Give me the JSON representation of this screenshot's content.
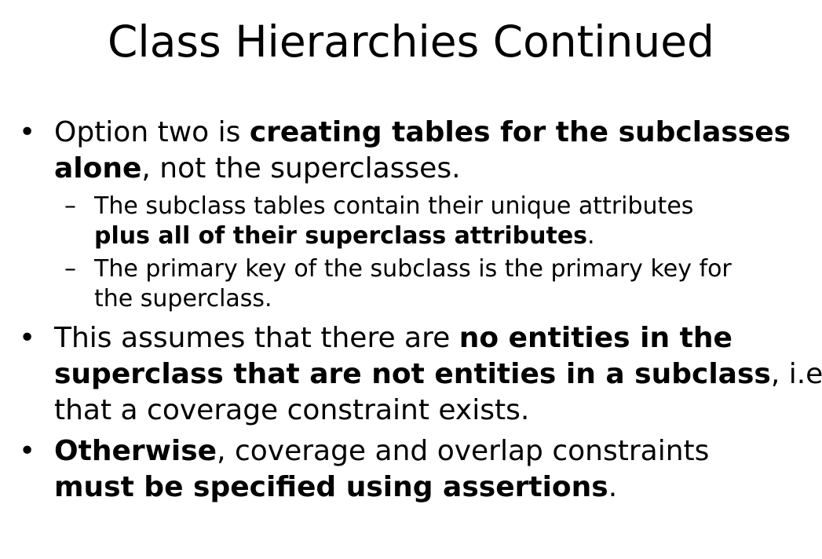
{
  "slide": {
    "title": "Class Hierarchies Continued",
    "bullet_marker": "•",
    "dash_marker": "–",
    "bullets": [
      {
        "line1_normal": "Option two is ",
        "line1_bold": "creating tables for the subclasses",
        "line2_bold": "alone",
        "line2_normal": ", not the superclasses."
      },
      {
        "line1": "The subclass tables contain their unique attributes",
        "line2_bold": "plus all of their superclass attributes",
        "line2_normal": "."
      },
      {
        "line1": "The primary key of the subclass is the primary key for",
        "line2": "the superclass."
      },
      {
        "line1_normal": "This assumes that there are ",
        "line1_bold": "no entities in the",
        "line2_bold": "superclass that are not entities in a subclass",
        "line2_normal": ", i.e.,",
        "line3": "that a coverage constraint exists."
      },
      {
        "line1_bold": "Otherwise",
        "line1_normal": ", coverage and overlap constraints",
        "line2_bold": "must be specified using assertions",
        "line2_normal": "."
      }
    ]
  }
}
